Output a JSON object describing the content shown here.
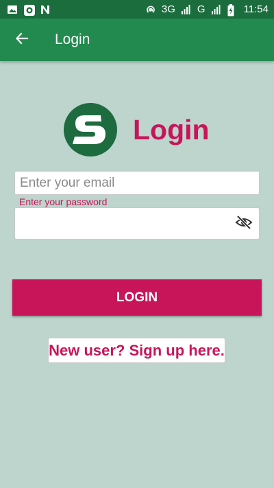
{
  "status_bar": {
    "network_3g": "3G",
    "network_g": "G",
    "time": "11:54",
    "icons": [
      "gallery-icon",
      "camera-circle-icon",
      "n-notification-icon",
      "hotspot-icon",
      "signal-icon",
      "battery-charging-icon"
    ]
  },
  "app_bar": {
    "title": "Login",
    "back_icon": "arrow-left-icon"
  },
  "logo": {
    "letter": "S",
    "heading": "Login"
  },
  "form": {
    "email_placeholder": "Enter your email",
    "email_value": "",
    "password_label": "Enter your password",
    "password_value": "",
    "toggle_icon": "eye-off-icon"
  },
  "actions": {
    "login_label": "LOGIN",
    "signup_label": "New user? Sign up here."
  },
  "colors": {
    "status_bar": "#1b6d3e",
    "app_bar": "#238a4f",
    "background": "#bdd5cd",
    "accent": "#c8155a",
    "logo_green": "#1e6b40"
  }
}
